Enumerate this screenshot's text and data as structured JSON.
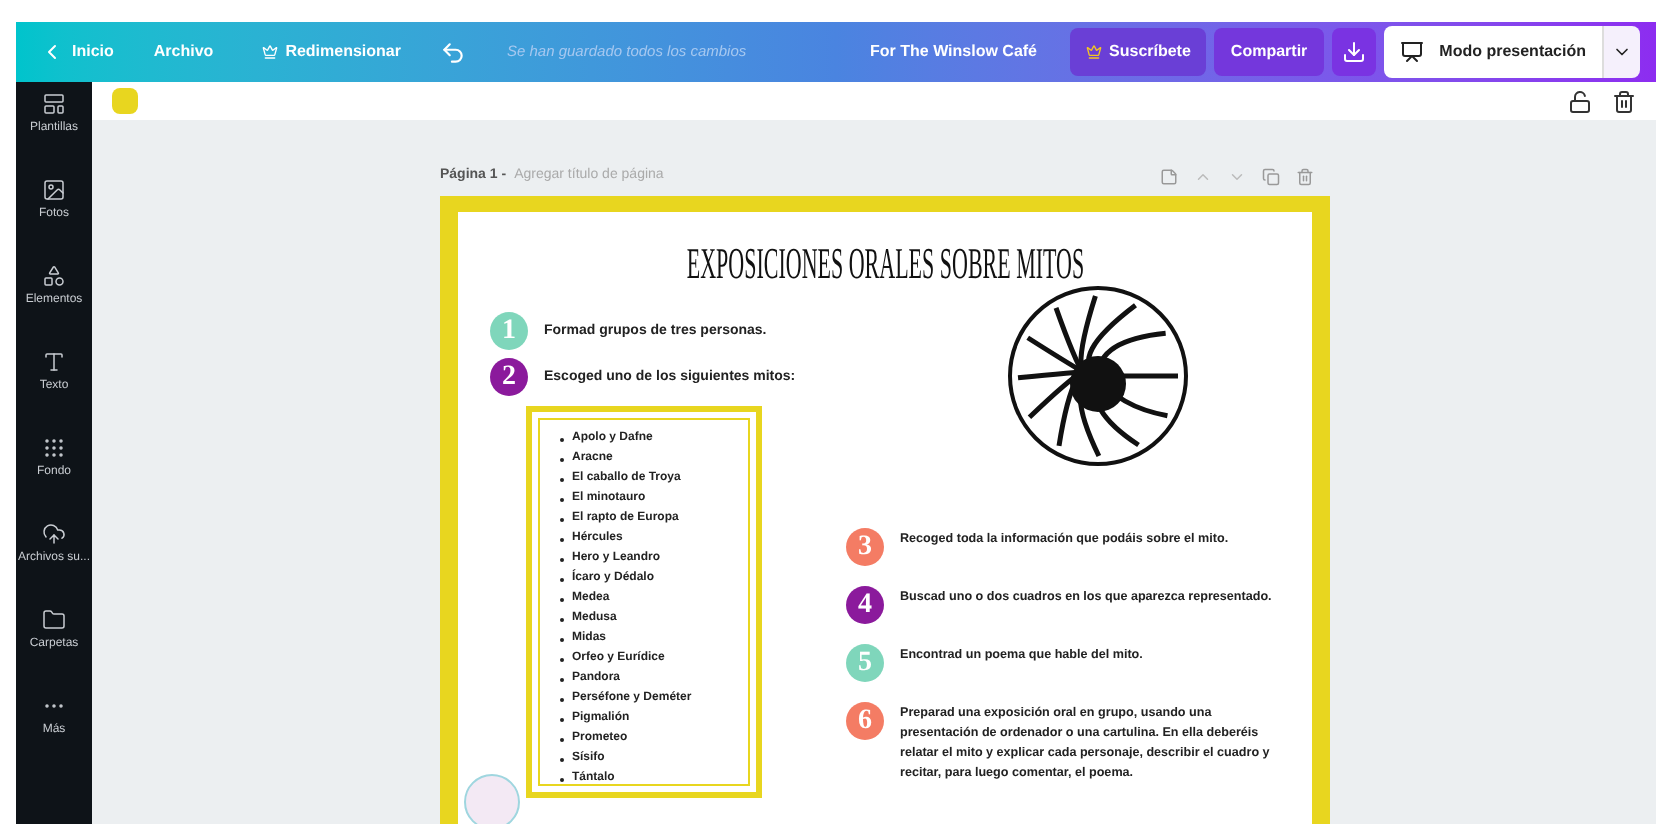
{
  "topbar": {
    "back": "Inicio",
    "menu": [
      "Archivo"
    ],
    "resize": "Redimensionar",
    "status": "Se han guardado todos los cambios",
    "doc_title": "For The Winslow Café",
    "subscribe": "Suscríbete",
    "share": "Compartir",
    "present": "Modo presentación"
  },
  "sidebar": {
    "items": [
      {
        "kind": "templates",
        "label": "Plantillas"
      },
      {
        "kind": "photos",
        "label": "Fotos"
      },
      {
        "kind": "elements",
        "label": "Elementos"
      },
      {
        "kind": "text",
        "label": "Texto"
      },
      {
        "kind": "background",
        "label": "Fondo"
      },
      {
        "kind": "uploads",
        "label": "Archivos su..."
      },
      {
        "kind": "folders",
        "label": "Carpetas"
      },
      {
        "kind": "more",
        "label": "Más"
      }
    ]
  },
  "toolbar": {
    "color": "#e8d61f"
  },
  "page": {
    "number": "Página 1 -",
    "title_placeholder": "Agregar título de página",
    "heading": "EXPOSICIONES ORALES SOBRE MITOS",
    "steps_left": [
      {
        "number": "1",
        "color": "#7fd6bb",
        "text": "Formad grupos de tres personas."
      },
      {
        "number": "2",
        "color": "#8b1a9c",
        "text": "Escoged uno de los siguientes mitos:"
      }
    ],
    "myths": [
      "Apolo y Dafne",
      "Aracne",
      "El caballo de Troya",
      "El minotauro",
      "El rapto de Europa",
      "Hércules",
      "Hero y Leandro",
      "Ícaro y Dédalo",
      "Medea",
      "Medusa",
      "Midas",
      "Orfeo y Eurídice",
      "Pandora",
      "Perséfone y Deméter",
      "Pigmalión",
      "Prometeo",
      "Sísifo",
      "Tántalo"
    ],
    "steps_right": [
      {
        "number": "3",
        "color": "#f47c64",
        "text": "Recoged toda la información que podáis sobre el mito."
      },
      {
        "number": "4",
        "color": "#8b1a9c",
        "text": "Buscad uno o dos cuadros en los que aparezca representado."
      },
      {
        "number": "5",
        "color": "#7fd6bb",
        "text": "Encontrad un poema que hable del mito."
      },
      {
        "number": "6",
        "color": "#f47c64",
        "text": "Preparad una exposición oral en grupo, usando una presentación de ordenador o una cartulina. En ella deberéis relatar el mito y explicar cada personaje, describir el cuadro y recitar, para luego comentar, el poema."
      }
    ]
  }
}
